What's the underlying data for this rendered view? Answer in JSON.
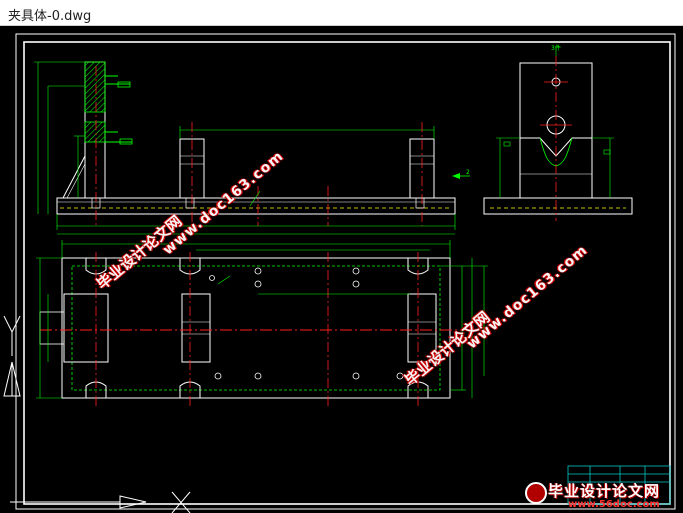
{
  "window": {
    "title": "夹具体-0.dwg"
  },
  "drawing": {
    "side_view_label": "3件",
    "arrow_label": "2"
  },
  "watermarks": {
    "cn_text": "毕业设计论文网",
    "url_text": "www.doc163.com"
  },
  "logo": {
    "cn_text": "毕业设计论文网",
    "url_text": "www.56doc.com"
  },
  "colors": {
    "background": "#000000",
    "frame": "#ffffff",
    "outline": "#ffffff",
    "dimension": "#00ff00",
    "centerline": "#ff2020",
    "hidden": "#ffff00",
    "hatch": "#00ff00",
    "watermark_accent": "#cc0000"
  }
}
